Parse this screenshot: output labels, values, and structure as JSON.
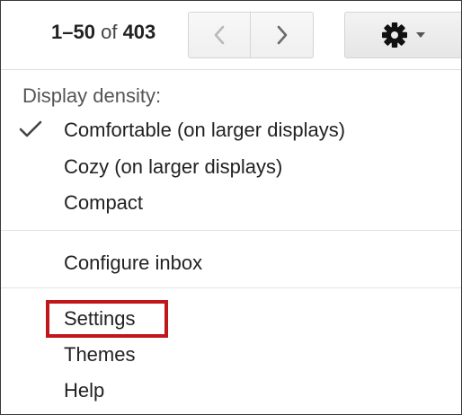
{
  "toolbar": {
    "count_range": "1–50",
    "count_of": "of",
    "count_total": "403",
    "prev_icon": "chevron-left-icon",
    "next_icon": "chevron-right-icon",
    "settings_icon": "gear-icon",
    "dropdown_icon": "caret-down-icon"
  },
  "menu": {
    "density_header": "Display density:",
    "density_options": [
      {
        "label": "Comfortable (on larger displays)",
        "checked": true
      },
      {
        "label": "Cozy (on larger displays)",
        "checked": false
      },
      {
        "label": "Compact",
        "checked": false
      }
    ],
    "configure_inbox": "Configure inbox",
    "settings": "Settings",
    "themes": "Themes",
    "help": "Help"
  },
  "colors": {
    "highlight": "#c0161c",
    "text": "#222222"
  }
}
